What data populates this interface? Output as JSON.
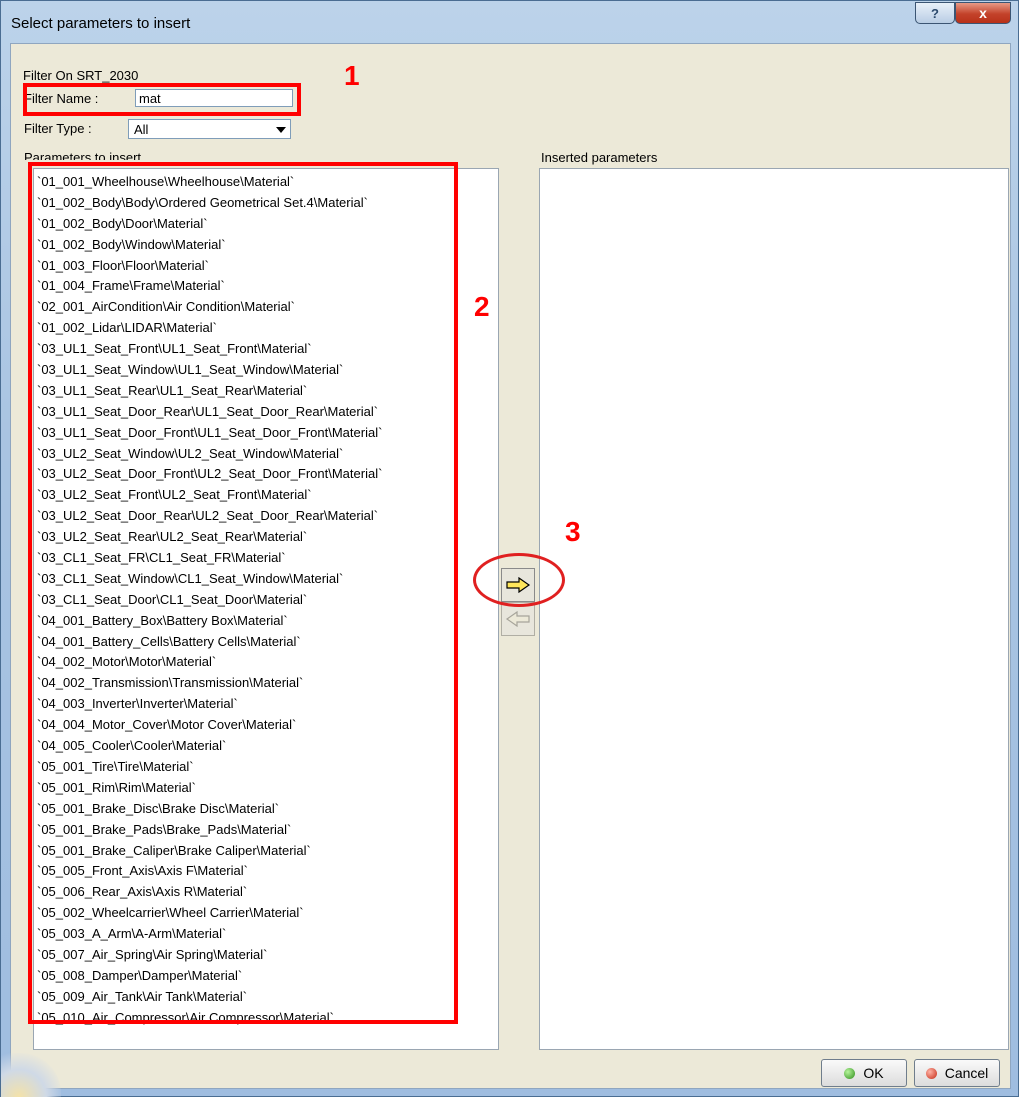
{
  "window": {
    "title": "Select parameters to insert",
    "help_label": "?",
    "close_label": "x"
  },
  "filter": {
    "on_label": "Filter On SRT_2030",
    "name_label": "Filter Name :",
    "name_value": "mat",
    "type_label": "Filter Type :",
    "type_value": "All"
  },
  "left_panel": {
    "title": "Parameters to insert",
    "items": [
      "`01_001_Wheelhouse\\Wheelhouse\\Material`",
      "`01_002_Body\\Body\\Ordered Geometrical Set.4\\Material`",
      "`01_002_Body\\Door\\Material`",
      "`01_002_Body\\Window\\Material`",
      "`01_003_Floor\\Floor\\Material`",
      "`01_004_Frame\\Frame\\Material`",
      "`02_001_AirCondition\\Air Condition\\Material`",
      "`01_002_Lidar\\LIDAR\\Material`",
      "`03_UL1_Seat_Front\\UL1_Seat_Front\\Material`",
      "`03_UL1_Seat_Window\\UL1_Seat_Window\\Material`",
      "`03_UL1_Seat_Rear\\UL1_Seat_Rear\\Material`",
      "`03_UL1_Seat_Door_Rear\\UL1_Seat_Door_Rear\\Material`",
      "`03_UL1_Seat_Door_Front\\UL1_Seat_Door_Front\\Material`",
      "`03_UL2_Seat_Window\\UL2_Seat_Window\\Material`",
      "`03_UL2_Seat_Door_Front\\UL2_Seat_Door_Front\\Material`",
      "`03_UL2_Seat_Front\\UL2_Seat_Front\\Material`",
      "`03_UL2_Seat_Door_Rear\\UL2_Seat_Door_Rear\\Material`",
      "`03_UL2_Seat_Rear\\UL2_Seat_Rear\\Material`",
      "`03_CL1_Seat_FR\\CL1_Seat_FR\\Material`",
      "`03_CL1_Seat_Window\\CL1_Seat_Window\\Material`",
      "`03_CL1_Seat_Door\\CL1_Seat_Door\\Material`",
      "`04_001_Battery_Box\\Battery Box\\Material`",
      "`04_001_Battery_Cells\\Battery Cells\\Material`",
      "`04_002_Motor\\Motor\\Material`",
      "`04_002_Transmission\\Transmission\\Material`",
      "`04_003_Inverter\\Inverter\\Material`",
      "`04_004_Motor_Cover\\Motor Cover\\Material`",
      "`04_005_Cooler\\Cooler\\Material`",
      "`05_001_Tire\\Tire\\Material`",
      "`05_001_Rim\\Rim\\Material`",
      "`05_001_Brake_Disc\\Brake Disc\\Material`",
      "`05_001_Brake_Pads\\Brake_Pads\\Material`",
      "`05_001_Brake_Caliper\\Brake Caliper\\Material`",
      "`05_005_Front_Axis\\Axis F\\Material`",
      "`05_006_Rear_Axis\\Axis R\\Material`",
      "`05_002_Wheelcarrier\\Wheel Carrier\\Material`",
      "`05_003_A_Arm\\A-Arm\\Material`",
      "`05_007_Air_Spring\\Air Spring\\Material`",
      "`05_008_Damper\\Damper\\Material`",
      "`05_009_Air_Tank\\Air Tank\\Material`",
      "`05_010_Air_Compressor\\Air Compressor\\Material`"
    ]
  },
  "right_panel": {
    "title": "Inserted parameters"
  },
  "transfer": {
    "add_icon": "arrow-right-icon",
    "remove_icon": "arrow-left-icon"
  },
  "buttons": {
    "ok_label": "OK",
    "cancel_label": "Cancel"
  },
  "annotations": {
    "label_1": "1",
    "label_2": "2",
    "label_3": "3",
    "color": "#ff0000"
  }
}
